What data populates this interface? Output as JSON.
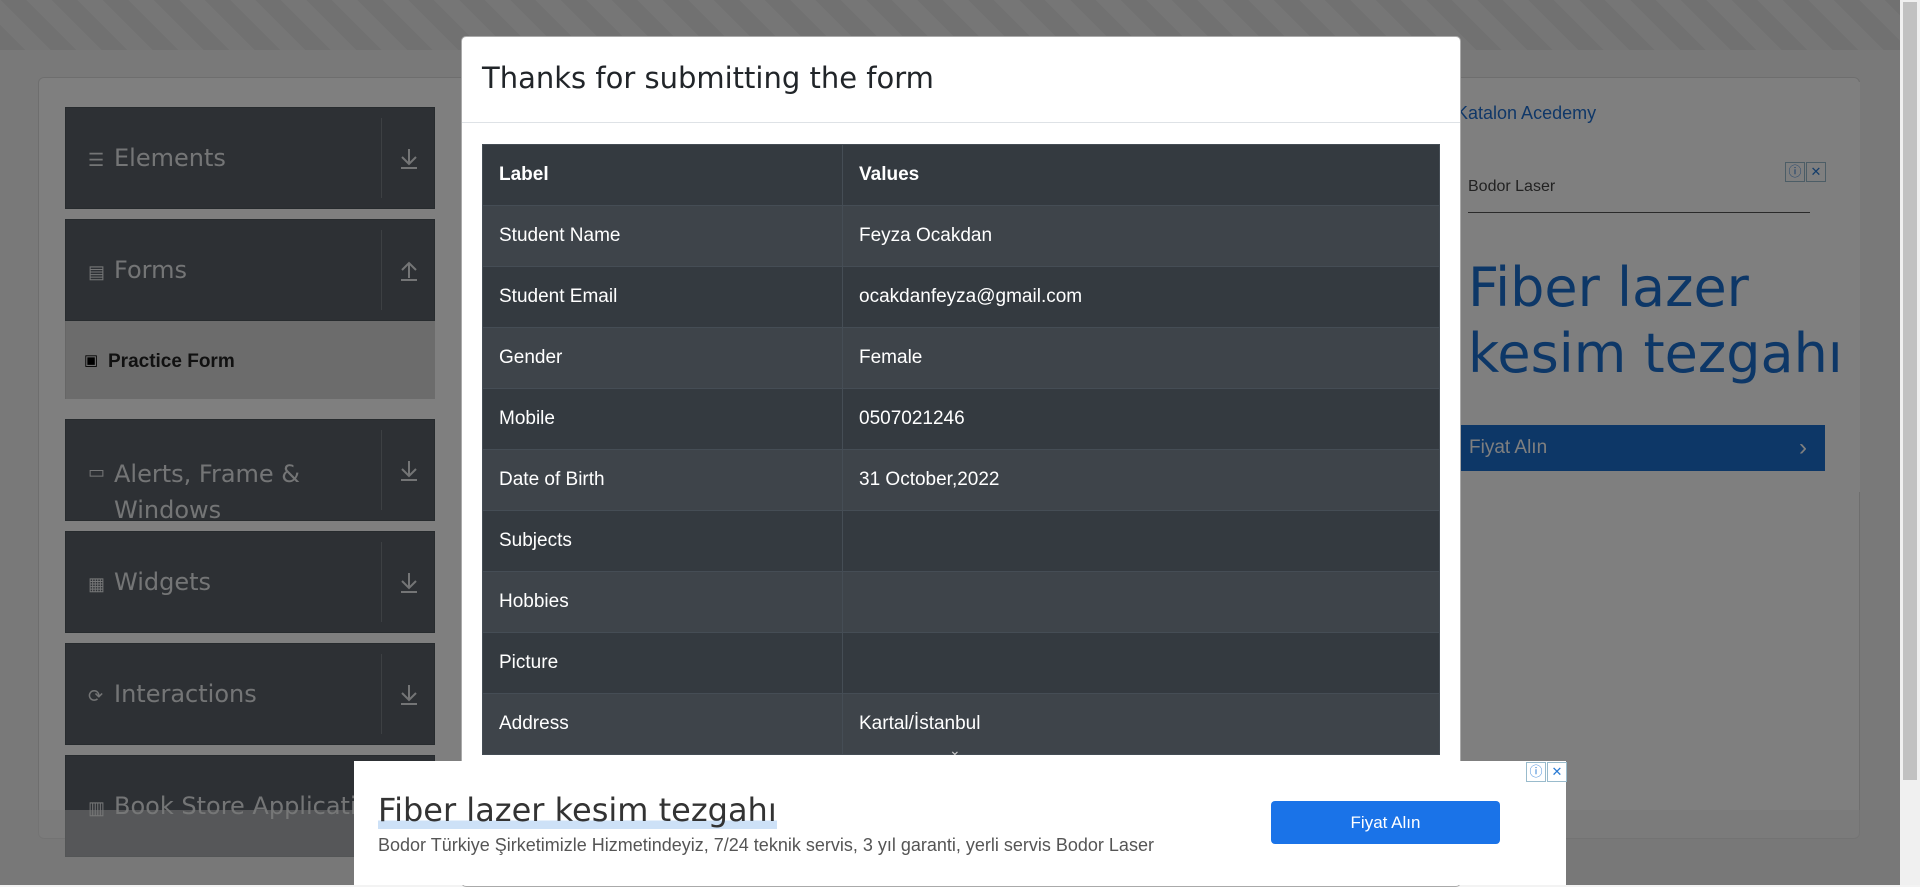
{
  "sidebar": {
    "groups": [
      {
        "label": "Elements",
        "icon": "hamburger-icon",
        "arrow": "download"
      },
      {
        "label": "Forms",
        "icon": "document-icon",
        "arrow": "upload"
      },
      {
        "label": "Alerts, Frame & Windows",
        "icon": "window-icon",
        "arrow": "download"
      },
      {
        "label": "Widgets",
        "icon": "widgets-icon",
        "arrow": "download"
      },
      {
        "label": "Interactions",
        "icon": "interactions-icon",
        "arrow": "download"
      },
      {
        "label": "Book Store Application",
        "icon": "books-icon",
        "arrow": "download"
      }
    ],
    "practice_form": "Practice Form"
  },
  "right_ad": {
    "katalon": "Katalon Acedemy",
    "brand": "Bodor Laser",
    "headline": "Fiber lazer kesim tezgahı",
    "cta": "Fiyat Alın"
  },
  "modal": {
    "title": "Thanks for submitting the form",
    "columns": [
      "Label",
      "Values"
    ],
    "rows": [
      {
        "label": "Student Name",
        "value": "Feyza Ocakdan"
      },
      {
        "label": "Student Email",
        "value": "ocakdanfeyza@gmail.com"
      },
      {
        "label": "Gender",
        "value": "Female"
      },
      {
        "label": "Mobile",
        "value": "0507021246"
      },
      {
        "label": "Date of Birth",
        "value": "31 October,2022"
      },
      {
        "label": "Subjects",
        "value": ""
      },
      {
        "label": "Hobbies",
        "value": ""
      },
      {
        "label": "Picture",
        "value": ""
      },
      {
        "label": "Address",
        "value": "Kartal/İstanbul"
      }
    ]
  },
  "bottom_ad": {
    "headline": "Fiber lazer kesim tezgahı",
    "description": "Bodor Türkiye Şirketimizle Hizmetindeyiz, 7/24 teknik servis, 3 yıl garanti, yerli servis Bodor Laser",
    "cta": "Fiyat Alın"
  },
  "colors": {
    "sidebar_group": "#5a6168",
    "table_dark": "#343a40",
    "ad_blue": "#1a6fcf"
  }
}
